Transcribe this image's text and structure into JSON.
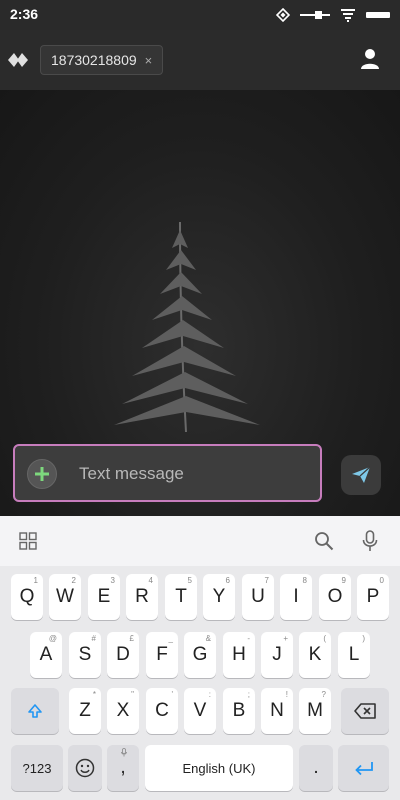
{
  "status_bar": {
    "time": "2:36",
    "icons": [
      "data-saver-icon",
      "signal-icon",
      "wifi-icon",
      "battery-icon"
    ]
  },
  "header": {
    "logo_icon": "app-logo-icon",
    "recipient": "18730218809",
    "recipient_close": "×",
    "contact_icon": "person-icon"
  },
  "composer": {
    "add_icon": "plus-icon",
    "placeholder": "Text message",
    "send_icon": "send-icon"
  },
  "keyboard": {
    "toolbar_icons": [
      "grid-icon",
      "search-icon",
      "mic-icon"
    ],
    "row1": [
      {
        "key": "Q",
        "sup": "1"
      },
      {
        "key": "W",
        "sup": "2"
      },
      {
        "key": "E",
        "sup": "3"
      },
      {
        "key": "R",
        "sup": "4"
      },
      {
        "key": "T",
        "sup": "5"
      },
      {
        "key": "Y",
        "sup": "6"
      },
      {
        "key": "U",
        "sup": "7"
      },
      {
        "key": "I",
        "sup": "8"
      },
      {
        "key": "O",
        "sup": "9"
      },
      {
        "key": "P",
        "sup": "0"
      }
    ],
    "row2": [
      {
        "key": "A",
        "sup": "@"
      },
      {
        "key": "S",
        "sup": "#"
      },
      {
        "key": "D",
        "sup": "£"
      },
      {
        "key": "F",
        "sup": "_"
      },
      {
        "key": "G",
        "sup": "&"
      },
      {
        "key": "H",
        "sup": "-"
      },
      {
        "key": "J",
        "sup": "+"
      },
      {
        "key": "K",
        "sup": "("
      },
      {
        "key": "L",
        "sup": ")"
      }
    ],
    "row3": [
      {
        "key": "Z",
        "sup": "*"
      },
      {
        "key": "X",
        "sup": "\""
      },
      {
        "key": "C",
        "sup": "'"
      },
      {
        "key": "V",
        "sup": ":"
      },
      {
        "key": "B",
        "sup": ";"
      },
      {
        "key": "N",
        "sup": "!"
      },
      {
        "key": "M",
        "sup": "?"
      }
    ],
    "shift_icon": "shift-arrow-icon",
    "backspace_icon": "backspace-icon",
    "symbols_label": "?123",
    "emoji_icon": "emoji-icon",
    "comma": ",",
    "space_label": "English (UK)",
    "period": ".",
    "enter_icon": "enter-icon"
  },
  "colors": {
    "composer_border": "#c77dbd",
    "add_icon": "#7dd87d",
    "send_icon": "#7ec8e8",
    "accent_blue": "#2196f3"
  }
}
